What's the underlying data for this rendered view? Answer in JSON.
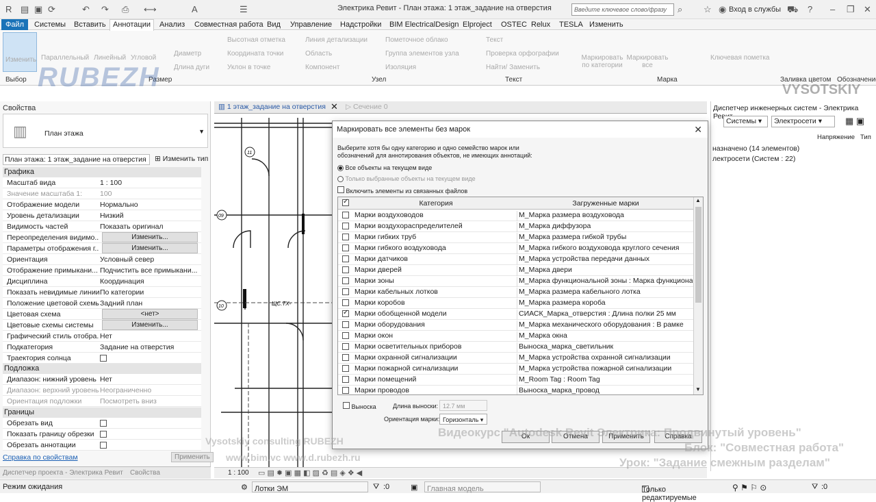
{
  "window": {
    "title": "Электрика Ревит - План этажа: 1 этаж_задание на отверстия",
    "search_placeholder": "Введите ключевое слово/фразу",
    "login": "Вход в службы"
  },
  "menu": [
    "Файл",
    "Системы",
    "Вставить",
    "Аннотации",
    "Анализ",
    "Совместная работа",
    "Вид",
    "Управление",
    "Надстройки",
    "BIM ElectricalDesign",
    "Elproject",
    "OSTEC",
    "Relux",
    "TESLA",
    "Изменить"
  ],
  "ribbon": {
    "buttons": [
      "Изменить",
      "Параллельный",
      "Линейный",
      "Угловой",
      "Диаметр",
      "Длина дуги",
      "Высотная отметка",
      "Координата точки",
      "Уклон в точке",
      "Линия детализации",
      "Область",
      "Компонент",
      "Пометочное облако",
      "Группа элементов узла",
      "Изоляция",
      "Текст",
      "Проверка орфографии",
      "Найти/ Заменить",
      "Маркировать по категории",
      "Маркировать все",
      "Ключевая пометка",
      "Заливка цветом",
      "Обозначение"
    ],
    "groups": [
      "Выбор",
      "Размер",
      "Узел",
      "Текст",
      "Марка"
    ],
    "logo": "RUBEZH",
    "vysotskiy": "VYSOTSKIY"
  },
  "properties": {
    "title": "Свойства",
    "type_name": "План этажа",
    "selector": "План этажа: 1 этаж_задание на отверстия",
    "edit_type": "Изменить тип",
    "sections": {
      "graphics": "Графика",
      "underlay": "Подложка",
      "extents": "Границы"
    },
    "rows_graphics": [
      {
        "k": "Масштаб вида",
        "v": "1 : 100"
      },
      {
        "k": "Значение масштаба    1:",
        "v": "100"
      },
      {
        "k": "Отображение модели",
        "v": "Нормально"
      },
      {
        "k": "Уровень детализации",
        "v": "Низкий"
      },
      {
        "k": "Видимость частей",
        "v": "Показать оригинал"
      },
      {
        "k": "Переопределения видимо...",
        "v": "Изменить..."
      },
      {
        "k": "Параметры отображения г...",
        "v": "Изменить..."
      },
      {
        "k": "Ориентация",
        "v": "Условный север"
      },
      {
        "k": "Отображение примыкани...",
        "v": "Подчистить все примыкани..."
      },
      {
        "k": "Дисциплина",
        "v": "Координация"
      },
      {
        "k": "Показать невидимые линии",
        "v": "По категории"
      },
      {
        "k": "Положение цветовой схемы",
        "v": "Задний план"
      },
      {
        "k": "Цветовая схема",
        "v": "<нет>"
      },
      {
        "k": "Цветовые схемы системы",
        "v": "Изменить..."
      },
      {
        "k": "Графический стиль отобра...",
        "v": "Нет"
      },
      {
        "k": "Подкатегория",
        "v": "Задание на отверстия"
      },
      {
        "k": "Траектория солнца",
        "v": ""
      }
    ],
    "rows_underlay": [
      {
        "k": "Диапазон: нижний уровень",
        "v": "Нет"
      },
      {
        "k": "Диапазон: верхний уровень",
        "v": "Неограниченно"
      },
      {
        "k": "Ориентация подложки",
        "v": "Посмотреть вниз"
      }
    ],
    "rows_extents": [
      {
        "k": "Обрезать вид",
        "v": ""
      },
      {
        "k": "Показать границу обрезки",
        "v": ""
      },
      {
        "k": "Обрезать аннотации",
        "v": ""
      }
    ],
    "help_link": "Справка по свойствам",
    "apply": "Применить",
    "bottom_tabs": [
      "Диспетчер проекта - Электрика Ревит",
      "Свойства"
    ]
  },
  "view_tabs": [
    "1 этаж_задание на отверстия",
    "Сечение 0"
  ],
  "view_scale": "1 : 100",
  "drawing_labels": [
    "11",
    "09",
    "10",
    "ЩС.ТХ-"
  ],
  "system_browser": {
    "title": "Диспетчер инженерных систем - Электрика Ревит",
    "filter1": "Системы",
    "filter2": "Электросети",
    "col_voltage": "Напряжение",
    "col_type": "Тип",
    "rows": [
      "назначено (14 элементов)",
      "лектросети (Систем : 22)"
    ]
  },
  "dialog": {
    "title": "Маркировать все элементы без марок",
    "intro": "Выберите хотя бы одну категорию и одно семейство марок или обозначений для аннотирования объектов, не имеющих аннотаций:",
    "opt_all": "Все объекты на текущем виде",
    "opt_selected": "Только выбранные объекты на текущем виде",
    "opt_linked": "Включить элементы из связанных файлов",
    "col_category": "Категория",
    "col_tags": "Загруженные марки",
    "rows": [
      {
        "cat": "Марки воздуховодов",
        "tag": "M_Марка размера воздуховода",
        "checked": false
      },
      {
        "cat": "Марки воздухораспределителей",
        "tag": "M_Марка диффузора",
        "checked": false
      },
      {
        "cat": "Марки гибких труб",
        "tag": "M_Марка размера гибкой трубы",
        "checked": false
      },
      {
        "cat": "Марки гибкого воздуховода",
        "tag": "M_Марка гибкого воздуховода круглого сечения",
        "checked": false
      },
      {
        "cat": "Марки датчиков",
        "tag": "M_Марка устройства передачи данных",
        "checked": false
      },
      {
        "cat": "Марки дверей",
        "tag": "M_Марка двери",
        "checked": false
      },
      {
        "cat": "Марки зоны",
        "tag": "M_Марка функциональной зоны : Марка функционал",
        "checked": false
      },
      {
        "cat": "Марки кабельных лотков",
        "tag": "M_Марка размера кабельного лотка",
        "checked": false
      },
      {
        "cat": "Марки коробов",
        "tag": "M_Марка размера короба",
        "checked": false
      },
      {
        "cat": "Марки обобщенной модели",
        "tag": "СИАСК_Марка_отверстия : Длина полки 25 мм",
        "checked": true
      },
      {
        "cat": "Марки оборудования",
        "tag": "M_Марка механического оборудования : В рамке",
        "checked": false
      },
      {
        "cat": "Марки окон",
        "tag": "M_Марка окна",
        "checked": false
      },
      {
        "cat": "Марки осветительных приборов",
        "tag": "Выноска_марка_светильник",
        "checked": false
      },
      {
        "cat": "Марки охранной сигнализации",
        "tag": "M_Марка устройства охранной сигнализации",
        "checked": false
      },
      {
        "cat": "Марки пожарной сигнализации",
        "tag": "M_Марка устройства пожарной сигнализации",
        "checked": false
      },
      {
        "cat": "Марки помещений",
        "tag": "M_Room Tag : Room Tag",
        "checked": false
      },
      {
        "cat": "Марки проводов",
        "tag": "Выноска_марка_провод",
        "checked": false
      }
    ],
    "leader_label": "Выноска",
    "leader_length_label": "Длина выноски:",
    "leader_length_value": "12.7 мм",
    "orientation_label": "Ориентация марки:",
    "orientation_value": "Горизонталь",
    "ok": "Ок",
    "cancel": "Отмена",
    "apply": "Применить",
    "help": "Справка"
  },
  "status": {
    "left": "Режим ожидания",
    "workset": "Лотки ЭМ",
    "zero": ":0",
    "model": "Главная модель",
    "editable": "Только редактируемые",
    "filter_zero": ":0"
  },
  "watermarks": {
    "left1": "Vysotskiy consulting  RUBEZH",
    "left2": "www.bim.vc          www.d.rubezh.ru",
    "right1": "Видеокурс \"Autodesk Revit Электрика: Продвинутый уровень\"",
    "right2": "Блок: \"Совместная работа\"",
    "right3": "Урок: \"Задание смежным разделам\""
  }
}
